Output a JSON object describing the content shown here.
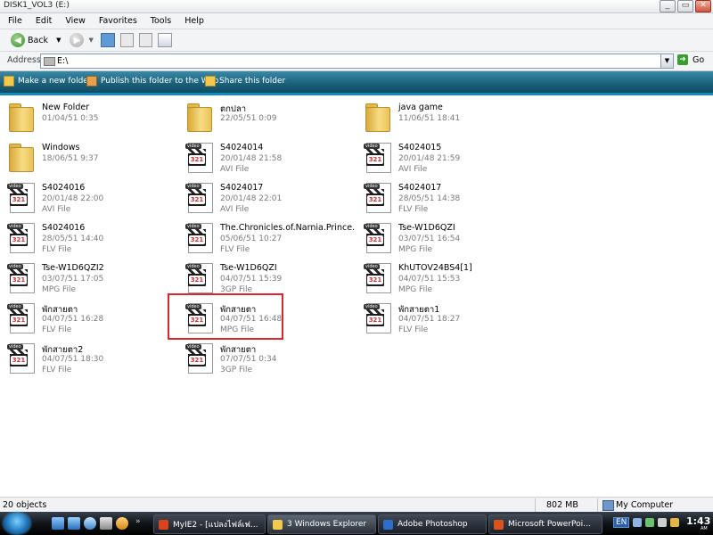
{
  "window": {
    "title": "DISK1_VOL3 (E:)",
    "buttons": [
      "_",
      "▭",
      "✕"
    ]
  },
  "menu": [
    "File",
    "Edit",
    "View",
    "Favorites",
    "Tools",
    "Help"
  ],
  "toolbar": {
    "back_label": "Back"
  },
  "address": {
    "label": "Address",
    "value": "E:\\",
    "go_label": "Go"
  },
  "tasks": {
    "new_folder": "Make a new folder",
    "publish": "Publish this folder to the Web",
    "share": "Share this folder"
  },
  "files": [
    {
      "name": "New Folder",
      "date": "01/04/51 0:35",
      "type": "",
      "kind": "folder",
      "col": 0,
      "row": 0
    },
    {
      "name": "ตกปลา",
      "date": "22/05/51 0:09",
      "type": "",
      "kind": "folder",
      "col": 1,
      "row": 0
    },
    {
      "name": "java game",
      "date": "11/06/51 18:41",
      "type": "",
      "kind": "folder",
      "col": 2,
      "row": 0
    },
    {
      "name": "Windows",
      "date": "18/06/51 9:37",
      "type": "",
      "kind": "folder",
      "col": 0,
      "row": 1
    },
    {
      "name": "S4024014",
      "date": "20/01/48 21:58",
      "type": "AVI File",
      "kind": "video",
      "col": 1,
      "row": 1
    },
    {
      "name": "S4024015",
      "date": "20/01/48 21:59",
      "type": "AVI File",
      "kind": "video",
      "col": 2,
      "row": 1
    },
    {
      "name": "S4024016",
      "date": "20/01/48 22:00",
      "type": "AVI File",
      "kind": "video",
      "col": 0,
      "row": 2
    },
    {
      "name": "S4024017",
      "date": "20/01/48 22:01",
      "type": "AVI File",
      "kind": "video",
      "col": 1,
      "row": 2
    },
    {
      "name": "S4024017",
      "date": "28/05/51 14:38",
      "type": "FLV File",
      "kind": "video",
      "col": 2,
      "row": 2
    },
    {
      "name": "S4024016",
      "date": "28/05/51 14:40",
      "type": "FLV File",
      "kind": "video",
      "col": 0,
      "row": 3
    },
    {
      "name": "The.Chronicles.of.Narnia.Prince.Cas...",
      "date": "05/06/51 10:27",
      "type": "FLV File",
      "kind": "video",
      "col": 1,
      "row": 3
    },
    {
      "name": "Tse-W1D6QZI",
      "date": "03/07/51 16:54",
      "type": "MPG File",
      "kind": "video",
      "col": 2,
      "row": 3
    },
    {
      "name": "Tse-W1D6QZI2",
      "date": "03/07/51 17:05",
      "type": "MPG File",
      "kind": "video",
      "col": 0,
      "row": 4
    },
    {
      "name": "Tse-W1D6QZI",
      "date": "04/07/51 15:39",
      "type": "3GP File",
      "kind": "video",
      "col": 1,
      "row": 4
    },
    {
      "name": "KhUTOV24BS4[1]",
      "date": "04/07/51 15:53",
      "type": "MPG File",
      "kind": "video",
      "col": 2,
      "row": 4
    },
    {
      "name": "พักสายตา",
      "date": "04/07/51 16:28",
      "type": "FLV File",
      "kind": "video",
      "col": 0,
      "row": 5
    },
    {
      "name": "พักสายตา",
      "date": "04/07/51 16:48",
      "type": "MPG File",
      "kind": "video",
      "col": 1,
      "row": 5
    },
    {
      "name": "พักสายตา1",
      "date": "04/07/51 18:27",
      "type": "FLV File",
      "kind": "video",
      "col": 2,
      "row": 5
    },
    {
      "name": "พักสายตา2",
      "date": "04/07/51 18:30",
      "type": "FLV File",
      "kind": "video",
      "col": 0,
      "row": 6
    },
    {
      "name": "พักสายตา",
      "date": "07/07/51 0:34",
      "type": "3GP File",
      "kind": "video",
      "col": 1,
      "row": 6
    }
  ],
  "video_icon": {
    "tag": "video",
    "number": "321"
  },
  "status": {
    "objects": "20 objects",
    "size": "802 MB",
    "location": "My Computer"
  },
  "taskbar": {
    "items": [
      {
        "label": "MyIE2 - [แปลงไฟล์เฟ...",
        "active": false,
        "color": "#d9441c"
      },
      {
        "label": "3 Windows Explorer",
        "active": true,
        "color": "#f2c94c"
      },
      {
        "label": "Adobe Photoshop",
        "active": false,
        "color": "#2a6fc9"
      },
      {
        "label": "Microsoft PowerPoi...",
        "active": false,
        "color": "#d9541c"
      }
    ],
    "lang": "EN",
    "time": "1:43",
    "ampm": "AM"
  }
}
